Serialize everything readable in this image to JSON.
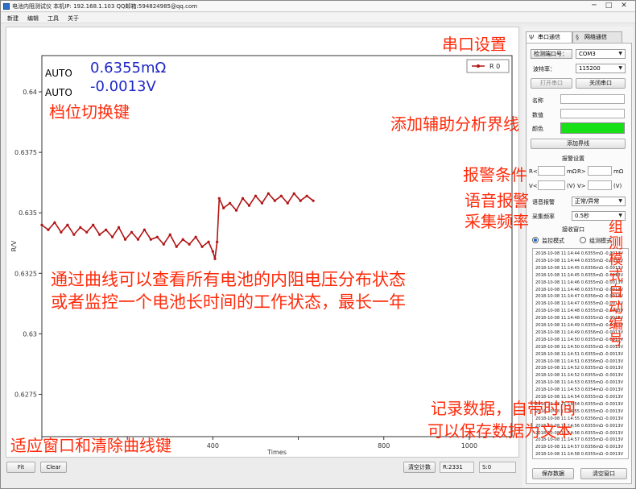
{
  "window": {
    "title": "电池内阻测试仪  本机IP: 192.168.1.103  QQ邮箱:594824985@qq.com",
    "controls": [
      "─",
      "□",
      "✕"
    ]
  },
  "menu": [
    "新建",
    "编辑",
    "工具",
    "关于"
  ],
  "readout": {
    "auto1": "AUTO",
    "auto2": "AUTO",
    "resistance": "0.6355mΩ",
    "voltage": "-0.0013V"
  },
  "chart_data": {
    "type": "line",
    "xlabel": "Times",
    "ylabel": "R/V",
    "xlim": [
      0,
      1100
    ],
    "ylim": [
      0.62575,
      0.6415
    ],
    "x_ticks": [
      0,
      200,
      400,
      600,
      800,
      1000
    ],
    "x_tick_labels": [
      "",
      "",
      "400",
      "",
      "800",
      "1000"
    ],
    "y_ticks": [
      0.6275,
      0.63,
      0.6325,
      0.635,
      0.6375,
      0.64
    ],
    "y_tick_labels": [
      "0.6275",
      "0.63",
      "0.6325",
      "0.635",
      "0.6375",
      "0.64"
    ],
    "legend": "R 0",
    "legend_position": "top-right",
    "series": [
      {
        "name": "R 0",
        "color": "#b11414",
        "points": [
          [
            0,
            0.6345
          ],
          [
            15,
            0.6343
          ],
          [
            30,
            0.6346
          ],
          [
            45,
            0.6342
          ],
          [
            60,
            0.6345
          ],
          [
            75,
            0.6341
          ],
          [
            90,
            0.6344
          ],
          [
            105,
            0.6342
          ],
          [
            120,
            0.6345
          ],
          [
            135,
            0.6341
          ],
          [
            150,
            0.6343
          ],
          [
            165,
            0.634
          ],
          [
            180,
            0.6344
          ],
          [
            195,
            0.6339
          ],
          [
            210,
            0.6342
          ],
          [
            225,
            0.6339
          ],
          [
            240,
            0.6343
          ],
          [
            255,
            0.6339
          ],
          [
            270,
            0.634
          ],
          [
            285,
            0.6337
          ],
          [
            300,
            0.6341
          ],
          [
            315,
            0.6336
          ],
          [
            330,
            0.6339
          ],
          [
            345,
            0.6337
          ],
          [
            360,
            0.634
          ],
          [
            375,
            0.6336
          ],
          [
            390,
            0.6338
          ],
          [
            400,
            0.6334
          ],
          [
            405,
            0.6331
          ],
          [
            410,
            0.6338
          ],
          [
            415,
            0.6356
          ],
          [
            425,
            0.6352
          ],
          [
            440,
            0.6354
          ],
          [
            455,
            0.6351
          ],
          [
            470,
            0.6356
          ],
          [
            485,
            0.6353
          ],
          [
            500,
            0.6357
          ],
          [
            515,
            0.6354
          ],
          [
            530,
            0.6358
          ],
          [
            545,
            0.6355
          ],
          [
            560,
            0.6357
          ],
          [
            575,
            0.6354
          ],
          [
            590,
            0.6358
          ],
          [
            605,
            0.6355
          ],
          [
            620,
            0.6357
          ],
          [
            635,
            0.6355
          ]
        ]
      }
    ]
  },
  "bottom": {
    "fit": "Fit",
    "clear": "Clear",
    "clear_stats": "清空计数",
    "r_count": "R:2331",
    "s_count": "S:0"
  },
  "panel": {
    "tab_serial": "串口通信",
    "tab_network": "网络通信",
    "detect_port": "检测端口号：",
    "port": "COM3",
    "baud_label": "波特率：",
    "baud": "115200",
    "open_port": "打开串口",
    "close_port": "关闭串口",
    "name_label": "名称",
    "value_label": "数值",
    "color_label": "颜色",
    "add_line": "添加界线",
    "alarm_settings": "报警设置",
    "r_lt": "R<",
    "r_gt": "R>",
    "unit_mohm1": "mΩ",
    "unit_mohm2": "mΩ",
    "v_lt": "V<",
    "v_gt": "V>",
    "unit_v1": "(V)",
    "unit_v2": "(V)",
    "voice_label": "语音报警",
    "voice_value": "正常/异常",
    "freq_label": "采集频率",
    "freq_value": "0.5秒",
    "receive_window": "接收窗口",
    "mode_monitor": "监控模式",
    "mode_group": "组测模式",
    "save_data": "保存数据",
    "clear_window": "清空窗口",
    "log": [
      "2018-10-08 11:14:44  0.6355mΩ  -0.0013V",
      "2018-10-08 11:14:44  0.6355mΩ  -0.0013V",
      "2018-10-08 11:14:45  0.6356mΩ  -0.0013V",
      "2018-10-08 11:14:45  0.6355mΩ  -0.0013V",
      "2018-10-08 11:14:46  0.6355mΩ  -0.0013V",
      "2018-10-08 11:14:46  0.6357mΩ  -0.0013V",
      "2018-10-08 11:14:47  0.6356mΩ  -0.0013V",
      "2018-10-08 11:14:47  0.6355mΩ  -0.0013V",
      "2018-10-08 11:14:48  0.6355mΩ  -0.0013V",
      "2018-10-08 11:14:48  0.6355mΩ  -0.0013V",
      "2018-10-08 11:14:49  0.6355mΩ  -0.0013V",
      "2018-10-08 11:14:49  0.6356mΩ  -0.0013V",
      "2018-10-08 11:14:50  0.6355mΩ  -0.0013V",
      "2018-10-08 11:14:50  0.6355mΩ  -0.0013V",
      "2018-10-08 11:14:51  0.6355mΩ  -0.0013V",
      "2018-10-08 11:14:51  0.6356mΩ  -0.0013V",
      "2018-10-08 11:14:52  0.6355mΩ  -0.0013V",
      "2018-10-08 11:14:52  0.6355mΩ  -0.0013V",
      "2018-10-08 11:14:53  0.6355mΩ  -0.0013V",
      "2018-10-08 11:14:53  0.6354mΩ  -0.0013V",
      "2018-10-08 11:14:54  0.6355mΩ  -0.0013V",
      "2018-10-08 11:14:54  0.6355mΩ  -0.0013V",
      "2018-10-08 11:14:55  0.6355mΩ  -0.0013V",
      "2018-10-08 11:14:55  0.6356mΩ  -0.0013V",
      "2018-10-08 11:14:56  0.6355mΩ  -0.0013V",
      "2018-10-08 11:14:56  0.6355mΩ  -0.0013V",
      "2018-10-08 11:14:57  0.6355mΩ  -0.0013V",
      "2018-10-08 11:14:57  0.6356mΩ  -0.0013V",
      "2018-10-08 11:14:58  0.6355mΩ  -0.0013V"
    ]
  },
  "annotations": {
    "serial_setup": "串口设置",
    "range_switch": "档位切换键",
    "aux_line": "添加辅助分析界线",
    "alarm_cond": "报警条件",
    "voice_alarm": "语音报警",
    "freq": "采集频率",
    "group_mode": "组测模式自动编号",
    "curve_line1": "通过曲线可以查看所有电池的内阻电压分布状态",
    "curve_line2": "或者监控一个电池长时间的工作状态，最长一年",
    "record_line1": "记录数据，自带时间",
    "record_line2": "可以保存数据为文本",
    "fit_clear": "适应窗口和清除曲线键"
  }
}
